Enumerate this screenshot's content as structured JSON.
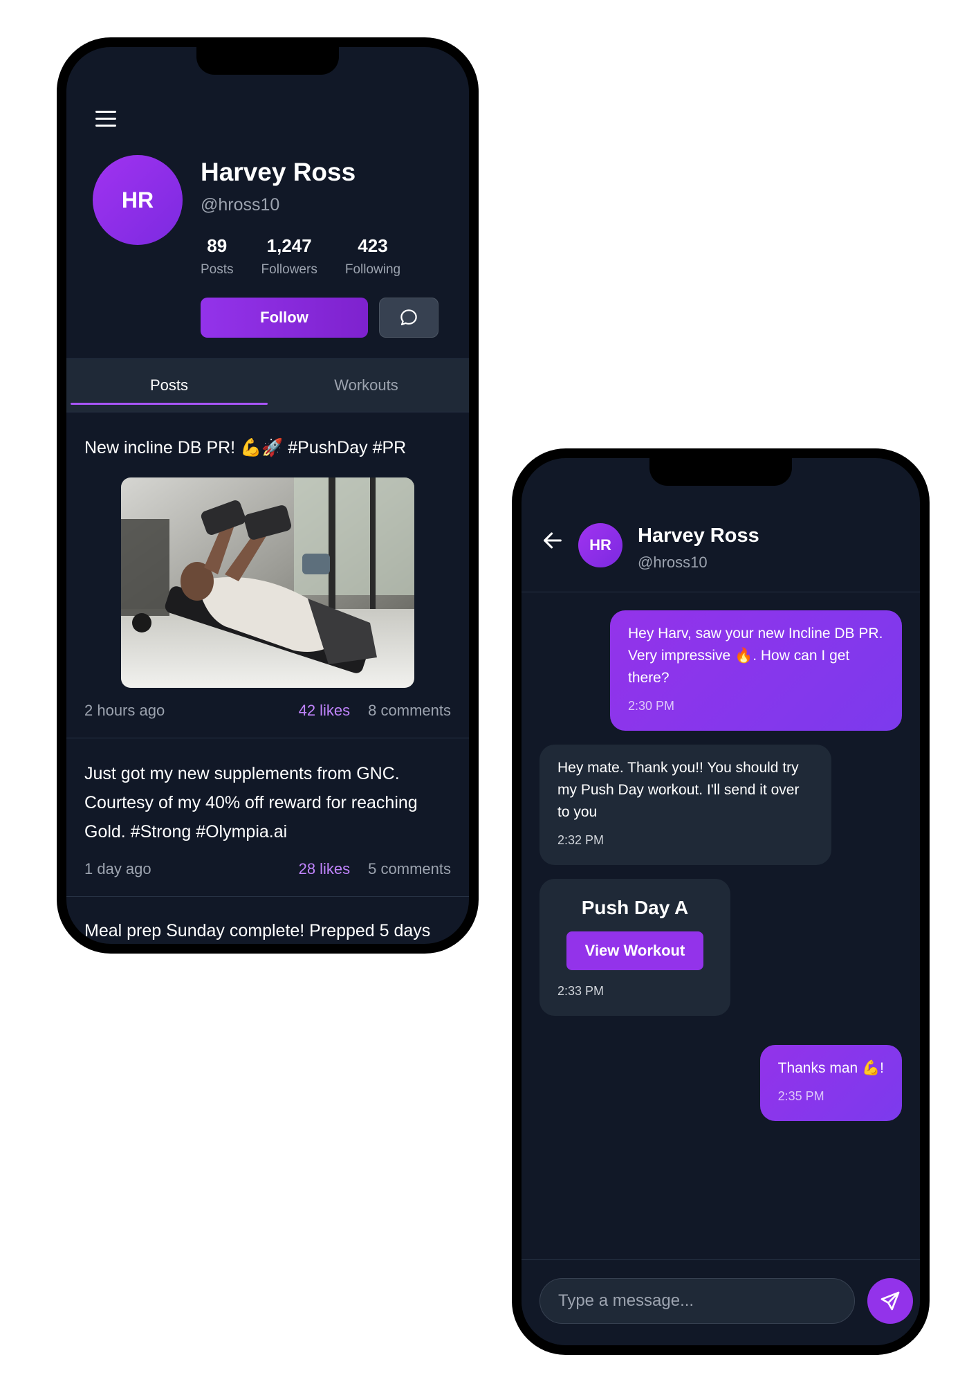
{
  "profile": {
    "avatar_initials": "HR",
    "name": "Harvey Ross",
    "handle": "@hross10",
    "stats": [
      {
        "value": "89",
        "label": "Posts"
      },
      {
        "value": "1,247",
        "label": "Followers"
      },
      {
        "value": "423",
        "label": "Following"
      }
    ],
    "follow_label": "Follow",
    "message_icon": "chat-bubble-icon",
    "menu_icon": "hamburger-menu-icon",
    "tabs": [
      {
        "label": "Posts",
        "active": true
      },
      {
        "label": "Workouts",
        "active": false
      }
    ],
    "posts": [
      {
        "text": "New incline DB PR! 💪🚀 #PushDay #PR",
        "time": "2 hours ago",
        "likes": "42 likes",
        "comments": "8 comments"
      },
      {
        "text": "Just got my new supplements from GNC. Courtesy of my 40% off reward for reaching Gold. #Strong #Olympia.ai",
        "time": "1 day ago",
        "likes": "28 likes",
        "comments": "5 comments"
      },
      {
        "text": "Meal prep Sunday complete! Prepped 5 days"
      }
    ]
  },
  "chat": {
    "back_icon": "arrow-left-icon",
    "avatar_initials": "HR",
    "name": "Harvey Ross",
    "handle": "@hross10",
    "messages": [
      {
        "direction": "outgoing",
        "text": "Hey Harv, saw your new Incline DB PR. Very impressive 🔥. How can I get there?",
        "time": "2:30 PM"
      },
      {
        "direction": "incoming",
        "text": "Hey mate. Thank you!! You should try my Push Day workout. I'll send it over to you",
        "time": "2:32 PM"
      },
      {
        "direction": "incoming",
        "workout_title": "Push Day A",
        "button_label": "View Workout",
        "time": "2:33 PM"
      },
      {
        "direction": "outgoing",
        "text": "Thanks man 💪!",
        "time": "2:35 PM"
      }
    ],
    "input_placeholder": "Type a message...",
    "send_icon": "send-icon"
  },
  "colors": {
    "background": "#111827",
    "surface": "#1f2937",
    "accent": "#9333ea",
    "accent_light": "#c084fc",
    "muted_text": "#9ca3af"
  }
}
